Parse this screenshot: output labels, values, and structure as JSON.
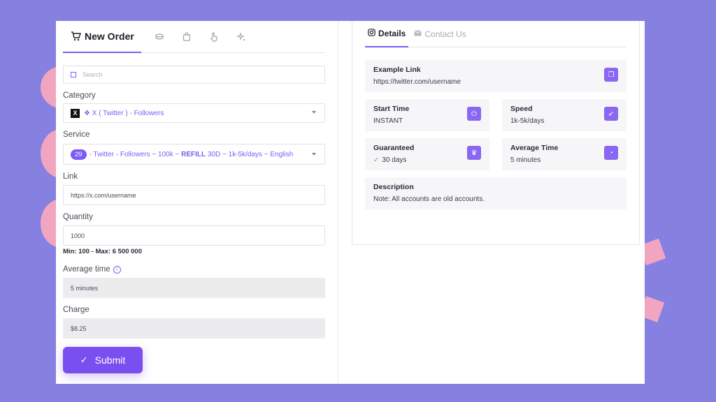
{
  "left_tabs": {
    "new_order": "New Order"
  },
  "search": {
    "placeholder": "Search"
  },
  "category": {
    "label": "Category",
    "value": "❖ X ( Twitter ) - Followers"
  },
  "service": {
    "label": "Service",
    "badge": "29",
    "text_pre": "- Twitter - Followers ~ 100k ~ ",
    "text_bold": "REFILL",
    "text_post": " 30D ~ 1k-5k/days ~ English"
  },
  "link": {
    "label": "Link",
    "placeholder": "https://x.com/username"
  },
  "quantity": {
    "label": "Quantity",
    "value": "1000",
    "minmax": "Min: 100 - Max: 6 500 000"
  },
  "average_time": {
    "label": "Average time",
    "value": "5 minutes"
  },
  "charge": {
    "label": "Charge",
    "value": "$8.25"
  },
  "submit": {
    "label": "Submit"
  },
  "right_tabs": {
    "details": "Details",
    "contact": "Contact Us"
  },
  "details": {
    "example_link": {
      "title": "Example Link",
      "value": "https://twitter.com/username"
    },
    "start_time": {
      "title": "Start Time",
      "value": "INSTANT"
    },
    "speed": {
      "title": "Speed",
      "value": "1k-5k/days"
    },
    "guaranteed": {
      "title": "Guaranteed",
      "value": "30 days"
    },
    "average_time": {
      "title": "Average Time",
      "value": "5 minutes"
    },
    "description": {
      "title": "Description",
      "value": "Note: All accounts are old accounts."
    }
  },
  "colors": {
    "accent": "#7c5cf5",
    "background": "#8680e0",
    "decoration": "#f0a6c0"
  }
}
